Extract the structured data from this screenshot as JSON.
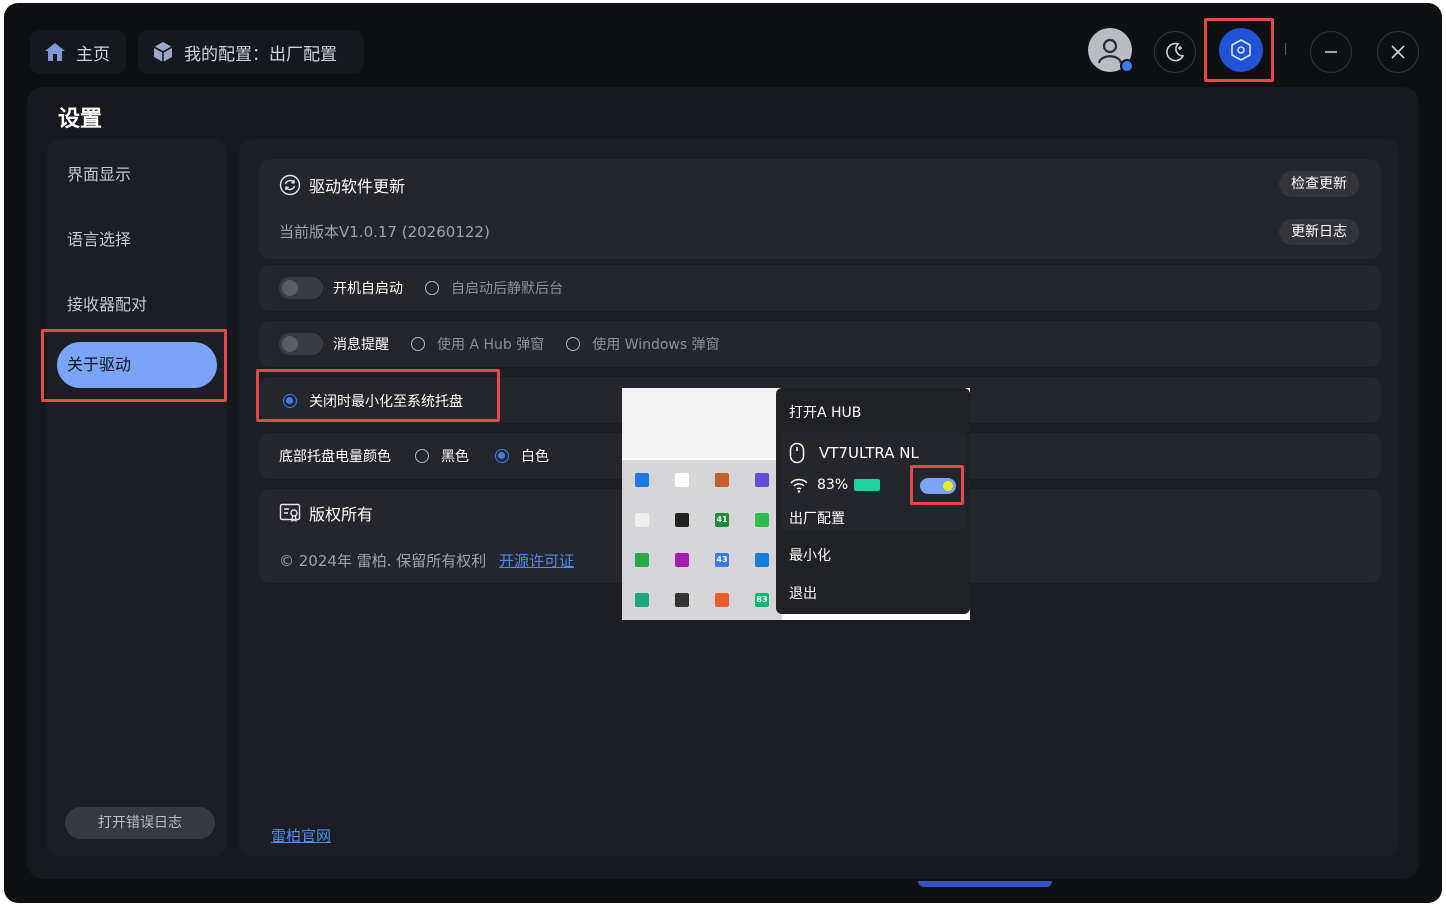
{
  "header": {
    "home_label": "主页",
    "config_label": "我的配置：出厂配置"
  },
  "panel": {
    "title": "设置"
  },
  "sidebar": {
    "items": [
      {
        "label": "界面显示"
      },
      {
        "label": "语言选择"
      },
      {
        "label": "接收器配对"
      },
      {
        "label": "关于驱动"
      }
    ],
    "active_index": 3,
    "log_button": "打开错误日志"
  },
  "update_card": {
    "title": "驱动软件更新",
    "check_button": "检查更新",
    "version_text": "当前版本V1.0.17 (20260122)",
    "changelog_button": "更新日志"
  },
  "autostart": {
    "label": "开机自启动",
    "option": "自启动后静默后台"
  },
  "notify": {
    "label": "消息提醒",
    "option_a": "使用 A Hub 弹窗",
    "option_b": "使用 Windows 弹窗"
  },
  "minimize": {
    "label": "关闭时最小化至系统托盘"
  },
  "tray_color": {
    "label": "底部托盘电量颜色",
    "black": "黑色",
    "white": "白色"
  },
  "copyright": {
    "title": "版权所有",
    "text": "© 2024年 雷柏. 保留所有权利",
    "license_link": "开源许可证"
  },
  "official_link": "雷柏官网",
  "tray_menu": {
    "open": "打开A HUB",
    "device": "VT7ULTRA NL",
    "battery": "83%",
    "profile": "出厂配置",
    "minimize": "最小化",
    "exit": "退出"
  },
  "tray_icons": [
    {
      "bg": "#1f7ae0",
      "text": ""
    },
    {
      "bg": "#ffffff",
      "text": ""
    },
    {
      "bg": "#c1602a",
      "text": ""
    },
    {
      "bg": "#5b4fd6",
      "text": ""
    },
    {
      "bg": "#eeeeee",
      "text": ""
    },
    {
      "bg": "#222222",
      "text": ""
    },
    {
      "bg": "#1d8a3a",
      "text": "41"
    },
    {
      "bg": "#2dbf4d",
      "text": ""
    },
    {
      "bg": "#2ba84a",
      "text": ""
    },
    {
      "bg": "#a41fb0",
      "text": ""
    },
    {
      "bg": "#3a7be0",
      "text": "43"
    },
    {
      "bg": "#1580d6",
      "text": ""
    },
    {
      "bg": "#1aa57a",
      "text": ""
    },
    {
      "bg": "#333333",
      "text": ""
    },
    {
      "bg": "#ef5a2a",
      "text": ""
    },
    {
      "bg": "#12b96d",
      "text": "83"
    }
  ],
  "colors": {
    "accent": "#2252d6",
    "active_item": "#7aa4f6",
    "highlight": "#e8484a",
    "battery": "#1ed39b"
  }
}
